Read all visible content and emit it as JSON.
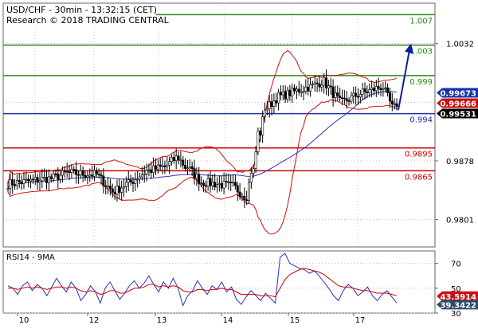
{
  "header": {
    "symbol_line": "USD/CHF - 30min - 13:32:15 (CET)",
    "research_line": "Research © 2018 TRADING CENTRAL"
  },
  "colors": {
    "green": "#2a8a12",
    "red": "#cc0000",
    "blue": "#1e2fa0",
    "candle": "#000000",
    "band_red": "#d21010",
    "ma_blue": "#3232b4",
    "rsi_red": "#cc0000",
    "rsi_blue": "#2f2fc0",
    "arrow": "#0d1f9a",
    "badge_blue": "#1634a8",
    "badge_red": "#cc1010",
    "badge_black": "#000000",
    "badge_slate": "#314a6a"
  },
  "chart_data": [
    {
      "type": "candlestick",
      "pair": "USD/CHF",
      "timeframe": "30min",
      "ylim": [
        0.9765,
        1.0085
      ],
      "x_ticks": [
        "10",
        "12",
        "13",
        "14",
        "15",
        "17"
      ],
      "y_ticks": [
        1.0032,
        0.9878,
        0.9801
      ],
      "levels": [
        {
          "value": 1.007,
          "label": "1.007",
          "color": "green"
        },
        {
          "value": 1.003,
          "label": "1.003",
          "color": "green"
        },
        {
          "value": 0.999,
          "label": "0.999",
          "color": "green"
        },
        {
          "value": 0.994,
          "label": "0.994",
          "color": "blue"
        },
        {
          "value": 0.9895,
          "label": "0.9895",
          "color": "red"
        },
        {
          "value": 0.9865,
          "label": "0.9865",
          "color": "red"
        }
      ],
      "price_badges": [
        {
          "value": 0.99673,
          "label": "0.99673",
          "color": "badge_blue"
        },
        {
          "value": 0.99666,
          "label": "0.99666",
          "color": "badge_red"
        },
        {
          "value": 0.99531,
          "label": "0.99531",
          "color": "badge_black"
        }
      ],
      "forecast_arrow": {
        "from": 0.9945,
        "to": 1.003
      },
      "segments": [
        {
          "bars": 6,
          "start": 0.9848,
          "end": 0.985
        },
        {
          "bars": 13,
          "start": 0.985,
          "end": 0.9855
        },
        {
          "bars": 8,
          "start": 0.9855,
          "end": 0.9862
        },
        {
          "bars": 12,
          "start": 0.9862,
          "end": 0.986
        },
        {
          "bars": 8,
          "start": 0.986,
          "end": 0.9838
        },
        {
          "bars": 6,
          "start": 0.9838,
          "end": 0.9848
        },
        {
          "bars": 9,
          "start": 0.9848,
          "end": 0.9865
        },
        {
          "bars": 7,
          "start": 0.9865,
          "end": 0.987
        },
        {
          "bars": 6,
          "start": 0.987,
          "end": 0.9882
        },
        {
          "bars": 4,
          "start": 0.9882,
          "end": 0.987
        },
        {
          "bars": 7,
          "start": 0.987,
          "end": 0.985
        },
        {
          "bars": 13,
          "start": 0.985,
          "end": 0.9845
        },
        {
          "bars": 6,
          "start": 0.9845,
          "end": 0.9832
        },
        {
          "bars": 3,
          "start": 0.9832,
          "end": 0.9865
        },
        {
          "bars": 3,
          "start": 0.9865,
          "end": 0.9915
        },
        {
          "bars": 3,
          "start": 0.9915,
          "end": 0.9948
        },
        {
          "bars": 6,
          "start": 0.9948,
          "end": 0.9963
        },
        {
          "bars": 13,
          "start": 0.9963,
          "end": 0.9975
        },
        {
          "bars": 6,
          "start": 0.9975,
          "end": 0.9982
        },
        {
          "bars": 8,
          "start": 0.9982,
          "end": 0.9955
        },
        {
          "bars": 10,
          "start": 0.9955,
          "end": 0.9968
        },
        {
          "bars": 8,
          "start": 0.9968,
          "end": 0.9975
        },
        {
          "bars": 5,
          "start": 0.9975,
          "end": 0.9948
        },
        {
          "bars": 2,
          "start": 0.9948,
          "end": 0.9953
        }
      ]
    },
    {
      "type": "line",
      "title": "RSI14 - 9MA",
      "ylim": [
        30,
        80
      ],
      "y_ticks": [
        70,
        50,
        30
      ],
      "x_ticks": [
        "10",
        "12",
        "13",
        "14",
        "15",
        "17"
      ],
      "value_badges": [
        {
          "value": 43.5914,
          "label": "43.5914",
          "color": "badge_red"
        },
        {
          "value": 39.3422,
          "label": "39.3422",
          "color": "badge_slate"
        }
      ],
      "series": [
        {
          "color": "rsi_blue",
          "values": [
            52,
            50,
            45,
            52,
            55,
            48,
            53,
            50,
            44,
            51,
            58,
            52,
            47,
            55,
            50,
            40,
            45,
            52,
            47,
            38,
            50,
            55,
            48,
            41,
            46,
            52,
            56,
            50,
            54,
            60,
            53,
            47,
            55,
            50,
            58,
            50,
            36,
            44,
            48,
            56,
            50,
            45,
            52,
            49,
            55,
            47,
            51,
            41,
            37,
            43,
            48,
            44,
            40,
            46,
            42,
            38,
            75,
            78,
            70,
            68,
            66,
            65,
            62,
            64,
            60,
            55,
            50,
            44,
            40,
            48,
            53,
            50,
            44,
            47,
            51,
            44,
            40,
            45,
            48,
            43,
            38
          ]
        },
        {
          "color": "rsi_red",
          "values": [
            50,
            50,
            49,
            50,
            51,
            50,
            51,
            50,
            49,
            50,
            51,
            51,
            50,
            51,
            50,
            48,
            47,
            48,
            47,
            45,
            46,
            48,
            48,
            46,
            46,
            48,
            50,
            50,
            51,
            53,
            53,
            51,
            52,
            51,
            52,
            51,
            48,
            47,
            47,
            49,
            49,
            48,
            49,
            49,
            50,
            49,
            49,
            47,
            45,
            45,
            45,
            45,
            44,
            44,
            44,
            43,
            50,
            57,
            61,
            63,
            65,
            66,
            65,
            64,
            63,
            61,
            58,
            55,
            52,
            51,
            51,
            50,
            49,
            48,
            48,
            47,
            46,
            46,
            46,
            45,
            44
          ]
        }
      ]
    }
  ]
}
